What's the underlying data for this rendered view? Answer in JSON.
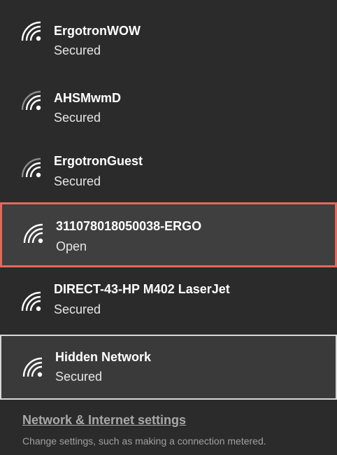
{
  "networks": [
    {
      "name": "ErgotronWOW",
      "status": "Secured",
      "icon": "wifi-signal-icon"
    },
    {
      "name": "AHSMwmD",
      "status": "Secured",
      "icon": "wifi-signal-icon"
    },
    {
      "name": "ErgotronGuest",
      "status": "Secured",
      "icon": "wifi-signal-icon"
    },
    {
      "name": "311078018050038-ERGO",
      "status": "Open",
      "icon": "wifi-signal-icon"
    },
    {
      "name": "DIRECT-43-HP M402 LaserJet",
      "status": "Secured",
      "icon": "wifi-signal-icon"
    },
    {
      "name": "Hidden Network",
      "status": "Secured",
      "icon": "wifi-signal-icon"
    }
  ],
  "settings": {
    "link_label": "Network & Internet settings",
    "description": "Change settings, such as making a connection metered."
  },
  "colors": {
    "background": "#2b2b2b",
    "highlight_border": "#e16a5a",
    "focus_border": "#d8d8d8"
  }
}
